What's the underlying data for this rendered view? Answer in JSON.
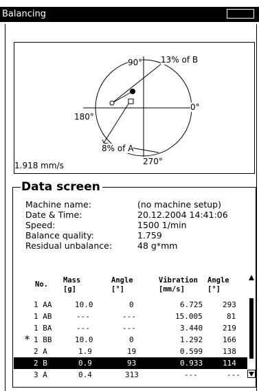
{
  "window": {
    "title": "Balancing"
  },
  "polar": {
    "label_90": "90°",
    "label_0": "0°",
    "label_180": "180°",
    "label_270": "270°",
    "label_b": "13% of B",
    "label_a": "8% of A",
    "residual": "1.918 mm/s"
  },
  "data_screen": {
    "heading": "Data screen",
    "info": [
      {
        "label": "Machine name:",
        "value": "(no machine setup)"
      },
      {
        "label": "Date & Time:",
        "value": "20.12.2004 14:41:06"
      },
      {
        "label": "Speed:",
        "value": "1500 1/min"
      },
      {
        "label": "Balance quality:",
        "value": "1.759"
      },
      {
        "label": "Residual unbalance:",
        "value": "48 g*mm"
      }
    ]
  },
  "table": {
    "headers": {
      "no": "No.",
      "mass": "Mass",
      "mass_unit": "[g]",
      "angle1": "Angle",
      "angle1_unit": "[°]",
      "vib": "Vibration",
      "vib_unit": "[mm/s]",
      "angle2": "Angle",
      "angle2_unit": "[°]"
    },
    "rows": [
      {
        "mark": "",
        "no": "1 AA",
        "mass": "10.0",
        "angle": "0",
        "vib": "6.725",
        "vangle": "293",
        "selected": false
      },
      {
        "mark": "",
        "no": "1 AB",
        "mass": "---",
        "angle": "---",
        "vib": "15.005",
        "vangle": "81",
        "selected": false
      },
      {
        "mark": "",
        "no": "1 BA",
        "mass": "---",
        "angle": "---",
        "vib": "3.440",
        "vangle": "219",
        "selected": false
      },
      {
        "mark": "*",
        "no": "1 BB",
        "mass": "10.0",
        "angle": "0",
        "vib": "1.292",
        "vangle": "166",
        "selected": false
      },
      {
        "mark": "",
        "no": "2 A",
        "mass": "1.9",
        "angle": "19",
        "vib": "0.599",
        "vangle": "138",
        "selected": false
      },
      {
        "mark": "",
        "no": "2 B",
        "mass": "0.9",
        "angle": "93",
        "vib": "0.933",
        "vangle": "114",
        "selected": true
      },
      {
        "mark": "",
        "no": "3 A",
        "mass": "0.4",
        "angle": "313",
        "vib": "---",
        "vangle": "---",
        "selected": false
      }
    ]
  }
}
